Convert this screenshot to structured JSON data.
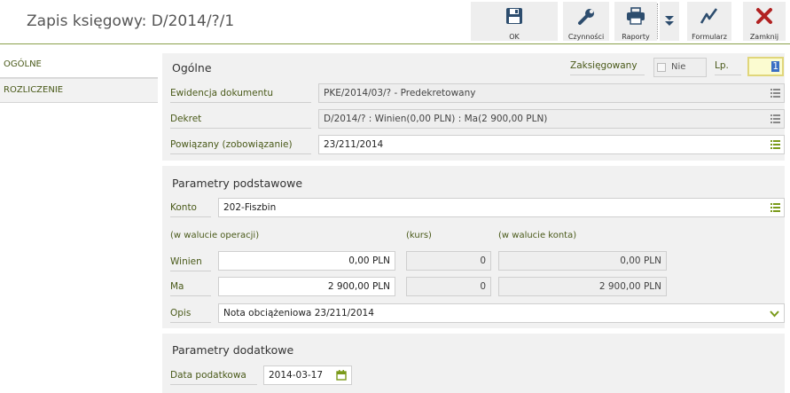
{
  "window": {
    "title": "Zapis księgowy: D/2014/?/1"
  },
  "toolbar": {
    "ok_label": "OK",
    "actions_label": "Czynności",
    "reports_label": "Raporty",
    "forms_label": "Formularz",
    "close_label": "Zamknij"
  },
  "sidebar": {
    "items": [
      {
        "label": "OGÓLNE"
      },
      {
        "label": "ROZLICZENIE"
      }
    ]
  },
  "general": {
    "heading": "Ogólne",
    "posted_label": "Zaksięgowany",
    "posted_value": "Nie",
    "lp_label": "Lp.",
    "lp_value": "1",
    "doc_label": "Ewidencja dokumentu",
    "doc_value": "PKE/2014/03/? - Predekretowany",
    "decree_label": "Dekret",
    "decree_value": "D/2014/? : Winien(0,00 PLN) : Ma(2 900,00 PLN)",
    "related_label": "Powiązany (zobowiązanie)",
    "related_value": "23/211/2014"
  },
  "basic": {
    "heading": "Parametry podstawowe",
    "account_label": "Konto",
    "account_value": "202-Fiszbin",
    "col_operation": "(w walucie operacji)",
    "col_rate": "(kurs)",
    "col_account": "(w walucie konta)",
    "debit_label": "Winien",
    "debit_value": "0,00 PLN",
    "debit_rate": "0",
    "debit_account": "0,00 PLN",
    "credit_label": "Ma",
    "credit_value": "2 900,00 PLN",
    "credit_rate": "0",
    "credit_account": "2 900,00 PLN",
    "desc_label": "Opis",
    "desc_value": "Nota obciążeniowa 23/211/2014"
  },
  "extra": {
    "heading": "Parametry dodatkowe",
    "taxdate_label": "Data podatkowa",
    "taxdate_value": "2014-03-17"
  },
  "colors": {
    "accent": "#8aa04a",
    "close": "#b22222",
    "label": "#4a5a1a"
  }
}
